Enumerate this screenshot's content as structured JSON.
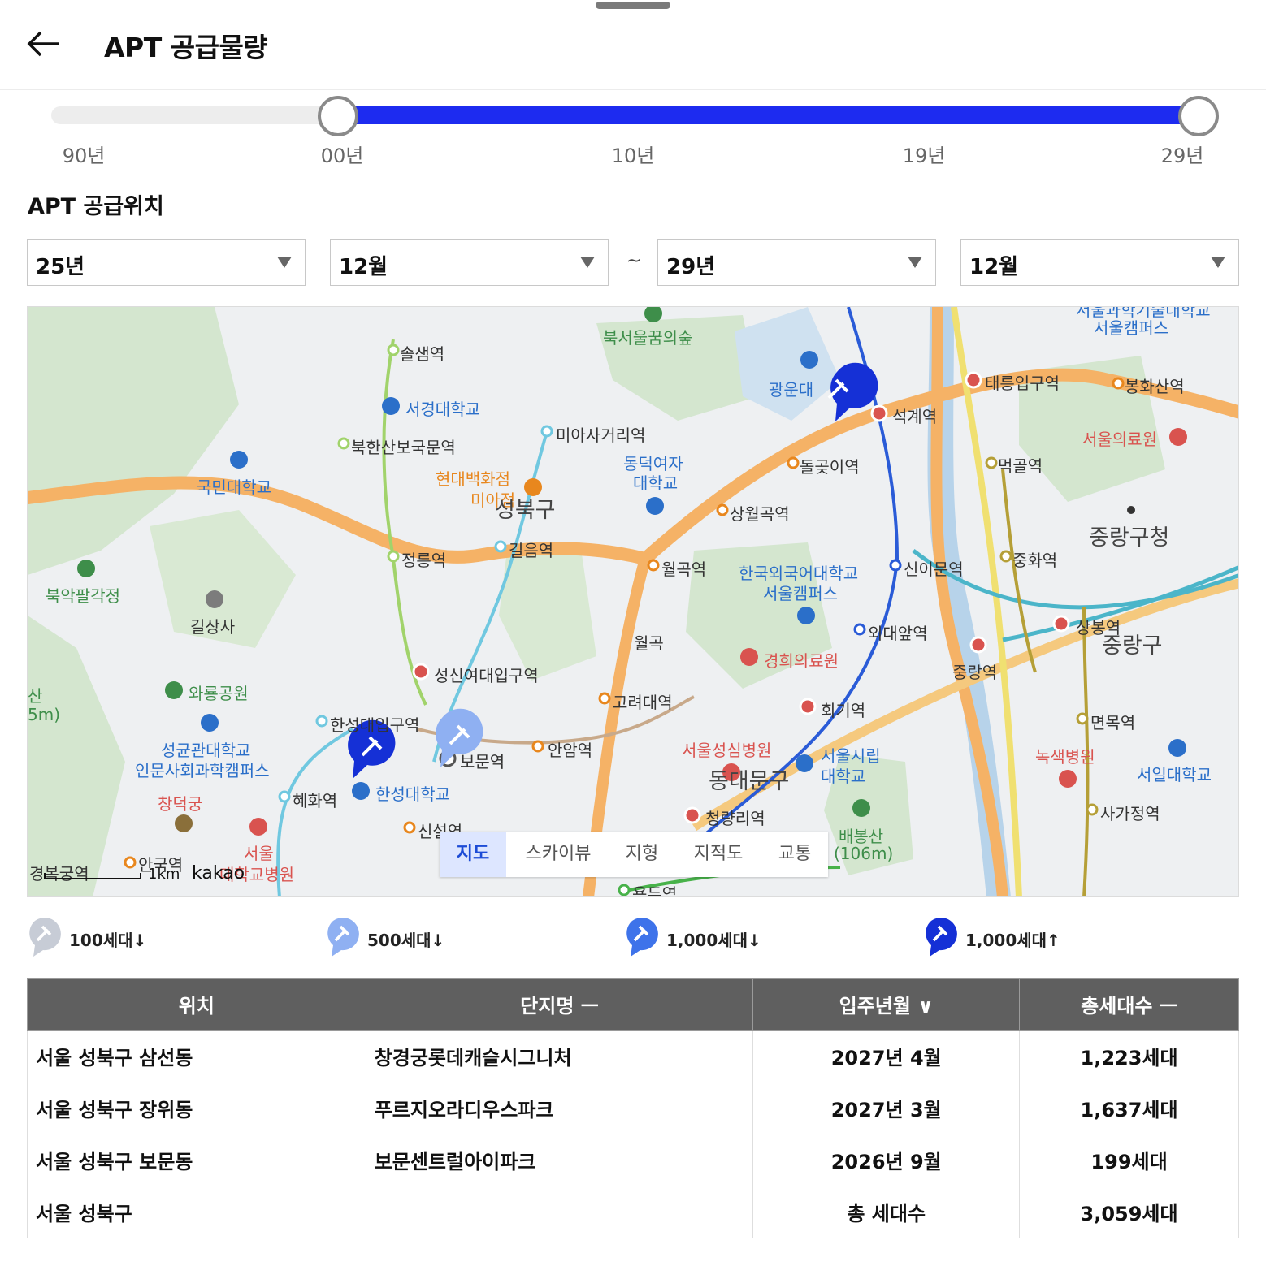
{
  "header": {
    "title": "APT 공급물량",
    "back_icon": "arrow-left-icon"
  },
  "range_slider": {
    "ticks": [
      "90년",
      "00년",
      "10년",
      "19년",
      "29년"
    ],
    "selected_start": "00년",
    "selected_end": "29년",
    "start_fraction": 0.25,
    "end_fraction": 1.0,
    "fill_color": "#1d2bf0"
  },
  "location": {
    "title": "APT 공급위치",
    "from_year": "25년",
    "from_month": "12월",
    "separator": "~",
    "to_year": "29년",
    "to_month": "12월"
  },
  "map": {
    "labels": {
      "sol": "솔샘역",
      "seokyeong": "서경대학교",
      "bukhansan": "북한산보국문역",
      "kookmin": "국민대학교",
      "hyundai1": "현대백화점",
      "hyundai2": "미아점",
      "seongbukgu": "성북구",
      "miasageori": "미아사거리역",
      "bukseoul": "북서울꿈의숲",
      "dongduk1": "동덕여자",
      "dongduk2": "대학교",
      "gwangun": "광운대",
      "seokgye": "석계역",
      "taereung": "태릉입구역",
      "bonghwasan": "봉화산역",
      "seoul_med": "서울의료원",
      "seoultech1": "서울과학기술대학교",
      "seoultech2": "서울캠퍼스",
      "dolgoji": "돌곶이역",
      "sangwolgok": "상월곡역",
      "meokgol": "먹골역",
      "jungnang_office": "중랑구청",
      "jeongneung": "정릉역",
      "gireum": "길음역",
      "wolgok": "월곡역",
      "hufs1": "한국외국어대학교",
      "hufs2": "서울캠퍼스",
      "sinimun": "신이문역",
      "junghwa": "중화역",
      "bukak": "북악팔각정",
      "gilsangsa": "길상사",
      "ic_wolgok": "월곡",
      "oedae": "외대앞역",
      "sangbong": "상봉역",
      "jungnanggu": "중랑구",
      "jungnang_st": "중랑역",
      "kyunghee_med": "경희의료원",
      "sungshin": "성신여대입구역",
      "waryong": "와룡공원",
      "goryeodae": "고려대역",
      "hoegi": "회기역",
      "myeonmok": "면목역",
      "hansungdae_st": "한성대입구역",
      "skku1": "성균관대학교",
      "skku2": "인문사회과학캠퍼스",
      "bomun": "보문역",
      "anam": "안암역",
      "seongsim": "서울성심병원",
      "dongdaemungu": "동대문구",
      "uos1": "서울시립",
      "uos2": "대학교",
      "noksaek": "녹색병원",
      "seoil": "서일대학교",
      "hyehwa": "혜화역",
      "hansung_univ": "한성대학교",
      "changdeokgung": "창덕궁",
      "snuh1": "서울",
      "snuh2": "대학교병원",
      "sinseol": "신설역",
      "cheongnyangni": "청량리역",
      "baebongsan1": "배봉산",
      "baebongsan2": "(106m)",
      "sagajeong": "사가정역",
      "anguk": "안국역",
      "gyeongbokgung": "경복궁역",
      "yongdu": "용두역",
      "bugaksan1": "산",
      "bugaksan2": "5m)"
    },
    "tabs": [
      "지도",
      "스카이뷰",
      "지형",
      "지적도",
      "교통"
    ],
    "active_tab": "지도",
    "scale": "1km",
    "provider": "kakao"
  },
  "legend": [
    {
      "label": "100세대↓",
      "color": "#c7ccd6"
    },
    {
      "label": "500세대↓",
      "color": "#8fb0f2"
    },
    {
      "label": "1,000세대↓",
      "color": "#3e73ea"
    },
    {
      "label": "1,000세대↑",
      "color": "#1530d6"
    }
  ],
  "table": {
    "headers": [
      "위치",
      "단지명 ㅡ",
      "입주년월 ∨",
      "총세대수 ㅡ"
    ],
    "rows": [
      [
        "서울 성북구 삼선동",
        "창경궁롯데캐슬시그니처",
        "2027년 4월",
        "1,223세대"
      ],
      [
        "서울 성북구 장위동",
        "푸르지오라디우스파크",
        "2027년 3월",
        "1,637세대"
      ],
      [
        "서울 성북구 보문동",
        "보문센트럴아이파크",
        "2026년 9월",
        "199세대"
      ]
    ],
    "summary": {
      "location": "서울 성북구",
      "label": "총 세대수",
      "total": "3,059세대"
    }
  }
}
